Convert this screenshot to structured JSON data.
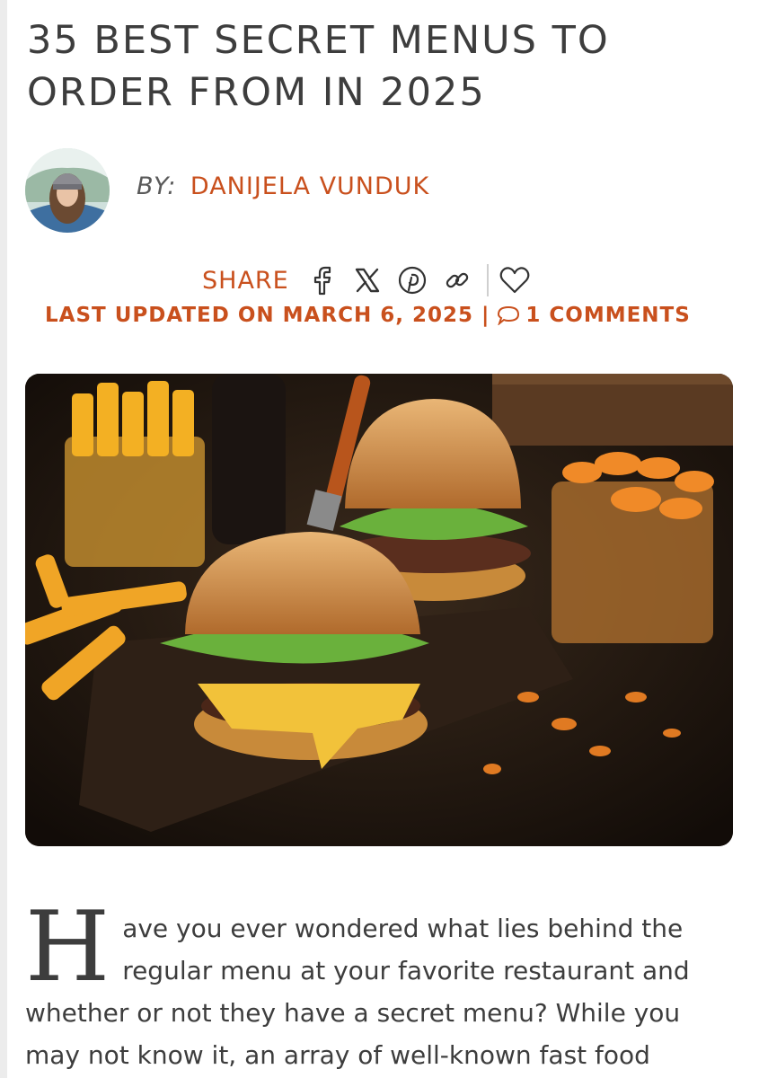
{
  "article": {
    "title": "35 BEST SECRET MENUS TO ORDER FROM IN 2025",
    "byline": {
      "label": "BY:",
      "author": "DANIJELA VUNDUK"
    },
    "share": {
      "label": "SHARE",
      "icons": [
        "facebook-icon",
        "x-icon",
        "pinterest-icon",
        "link-icon",
        "heart-icon"
      ]
    },
    "meta": {
      "updated": "LAST UPDATED ON MARCH 6, 2025",
      "separator": "|",
      "comments": "1 COMMENTS"
    },
    "hero_image": {
      "subject": "two cheeseburgers with fries and potato chips on a wooden board"
    },
    "intro": {
      "dropcap": "H",
      "text": "ave you ever wondered what lies behind the regular menu at your favorite restaurant and whether or not they have a secret menu? While you may not know it, an array of well-known fast food"
    }
  },
  "colors": {
    "accent": "#c9501d",
    "text": "#3d3d3d"
  }
}
